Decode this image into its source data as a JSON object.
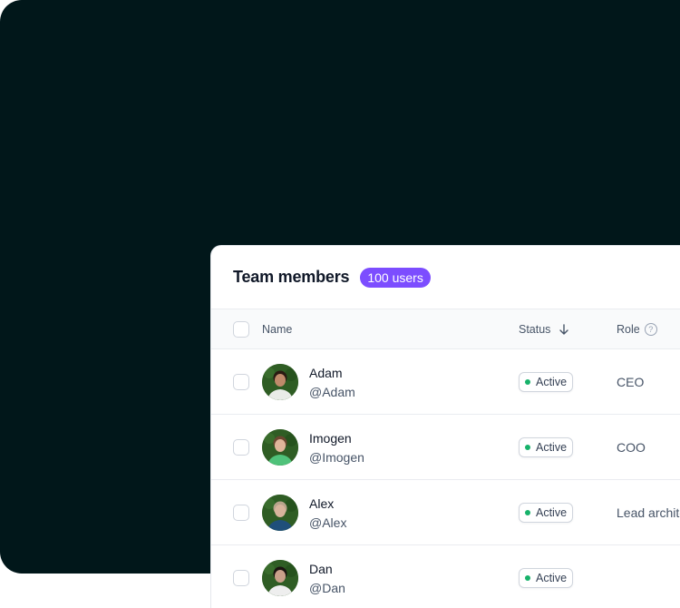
{
  "card": {
    "title": "Team members",
    "count_badge": "100 users"
  },
  "table": {
    "columns": {
      "name": "Name",
      "status": "Status",
      "status_sort_icon": "arrow-down-icon",
      "role": "Role",
      "role_help_icon": "help-circle-icon",
      "role_help_glyph": "?"
    },
    "rows": [
      {
        "name": "Adam",
        "handle": "@Adam",
        "status": "Active",
        "role": "CEO",
        "avatar": "photo-adam",
        "skin": "#c08a6a",
        "hair": "#2a1a12",
        "shirt": "#e9ece8"
      },
      {
        "name": "Imogen",
        "handle": "@Imogen",
        "status": "Active",
        "role": "COO",
        "avatar": "photo-imogen",
        "skin": "#e0b59a",
        "hair": "#6b4630",
        "shirt": "#4fc27a"
      },
      {
        "name": "Alex",
        "handle": "@Alex",
        "status": "Active",
        "role": "Lead architect",
        "avatar": "photo-alex",
        "skin": "#d8b49c",
        "hair": "#b9a48c",
        "shirt": "#1f4f7a"
      },
      {
        "name": "Dan",
        "handle": "@Dan",
        "status": "Active",
        "role": "",
        "avatar": "photo-dan",
        "skin": "#c9a08a",
        "hair": "#1b1410",
        "shirt": "#eeeeee"
      }
    ]
  },
  "colors": {
    "backdrop": "#01171a",
    "badge": "#7c4dff",
    "status_active": "#17b26a"
  }
}
